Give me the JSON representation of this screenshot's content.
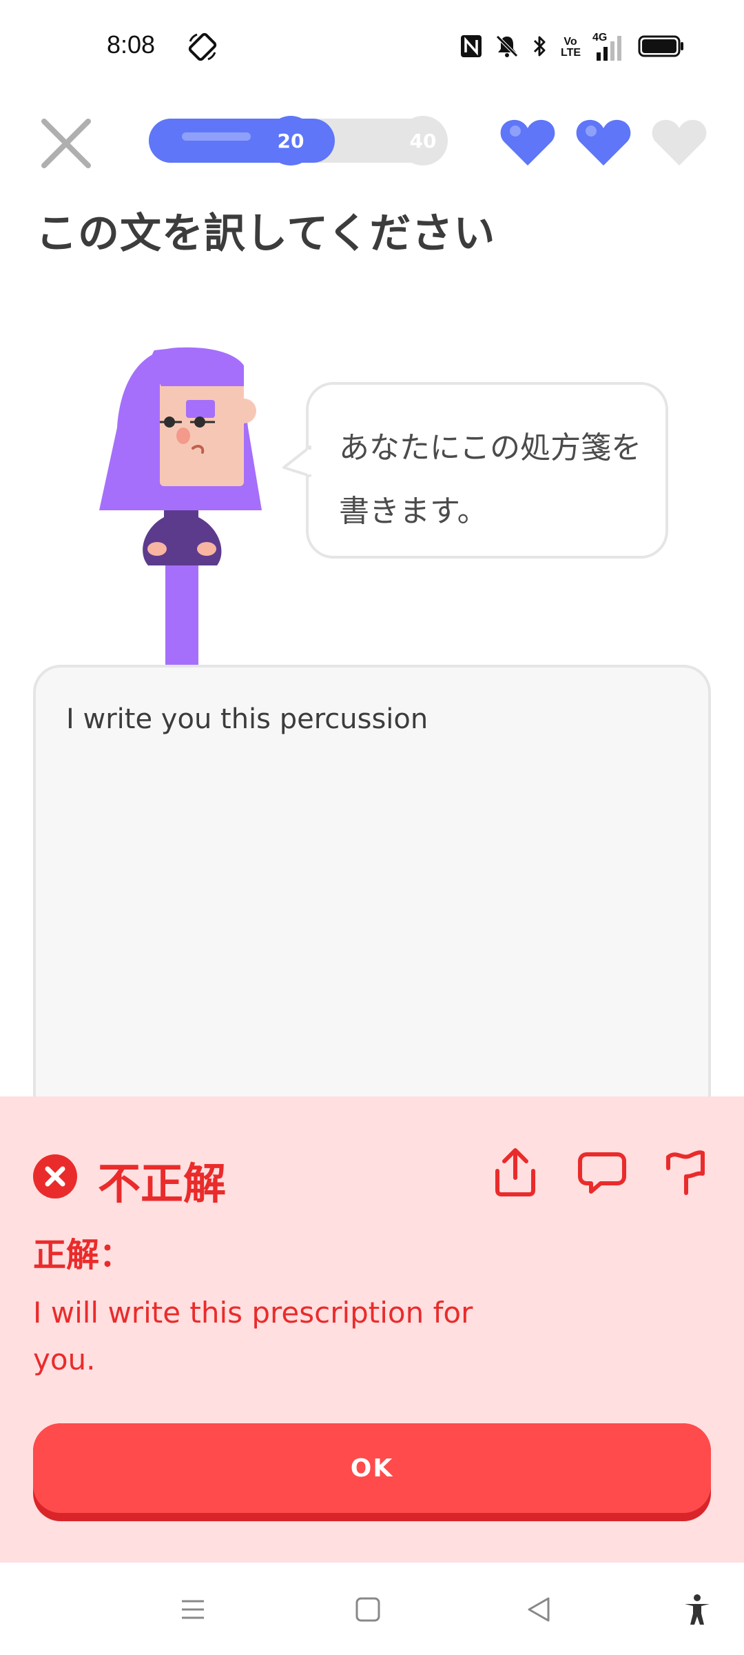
{
  "status_bar": {
    "time": "8:08",
    "icons": [
      "rotate-icon",
      "nfc-icon",
      "mute-icon",
      "bluetooth-icon",
      "volte-icon",
      "signal-4g-icon",
      "battery-icon"
    ],
    "network_label": "4G",
    "volte_label": "Vo LTE"
  },
  "top_bar": {
    "progress": {
      "fraction": 0.625,
      "milestone_current": "20",
      "milestone_next": "40"
    },
    "hearts_filled": 2,
    "hearts_total": 3,
    "accent_color": "#5e76f7"
  },
  "instruction": "この文を訳してください",
  "prompt_sentence": "あなたにこの処方箋を書きます。",
  "answer_value": "I write you this percussion",
  "feedback": {
    "title": "不正解",
    "correct_label": "正解：",
    "correct_answer": "I will write this prescription for you.",
    "color": "#ea2b2b",
    "background": "#ffdfe0",
    "actions": [
      "share-icon",
      "comment-icon",
      "flag-icon"
    ]
  },
  "ok_button": "OK",
  "nav_bar": [
    "menu-icon",
    "home-icon",
    "back-icon",
    "accessibility-icon"
  ]
}
